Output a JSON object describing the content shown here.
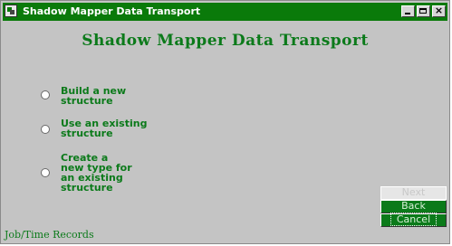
{
  "window": {
    "title": "Shadow Mapper Data Transport",
    "icons": {
      "app": "app-icon",
      "minimize": "minimize-icon",
      "maximize": "maximize-icon",
      "close": "close-icon"
    },
    "close_glyph": "×"
  },
  "heading": "Shadow Mapper Data Transport",
  "options": [
    {
      "label": "Build a new structure",
      "selected": false
    },
    {
      "label": "Use an existing structure",
      "selected": false
    },
    {
      "label": "Create a new type for an existing structure",
      "selected": false
    }
  ],
  "buttons": {
    "next_label": "Next",
    "back_label": "Back",
    "cancel_label": "Cancel"
  },
  "status": "Job/Time Records",
  "colors": {
    "accent": "#0b7a1a",
    "titlebar": "#0a7a0a",
    "background": "#c4c4c4"
  }
}
